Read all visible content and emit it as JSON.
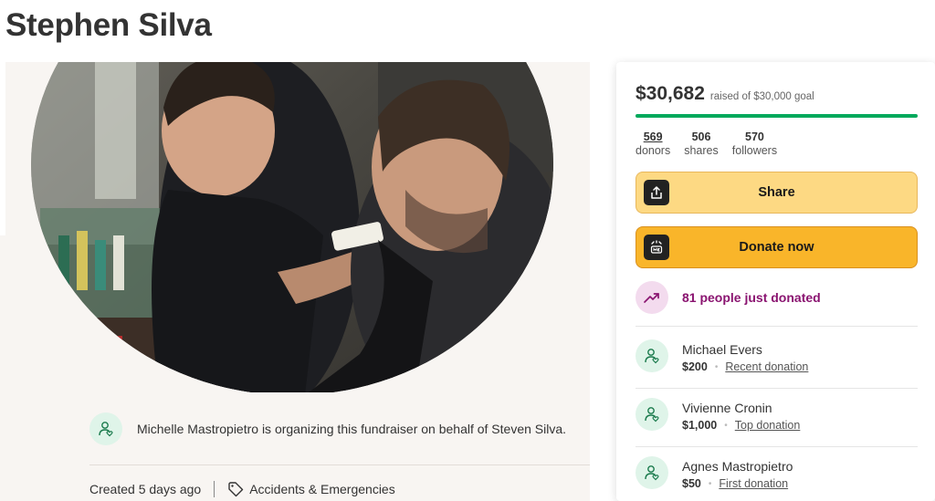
{
  "page": {
    "title": "Stephen Silva"
  },
  "organizer": {
    "text": "Michelle Mastropietro is organizing this fundraiser on behalf of Steven Silva."
  },
  "meta": {
    "created": "Created 5 days ago",
    "category": "Accidents & Emergencies"
  },
  "summary": {
    "raised": "$30,682",
    "goal_text": "raised of $30,000 goal",
    "progress_fraction": 1.0,
    "stats": [
      {
        "num": "569",
        "label": "donors"
      },
      {
        "num": "506",
        "label": "shares"
      },
      {
        "num": "570",
        "label": "followers"
      }
    ],
    "share_label": "Share",
    "donate_label": "Donate now",
    "trend_text": "81 people just donated"
  },
  "donations": [
    {
      "name": "Michael Evers",
      "amount": "$200",
      "kind": "Recent donation"
    },
    {
      "name": "Vivienne Cronin",
      "amount": "$1,000",
      "kind": "Top donation"
    },
    {
      "name": "Agnes Mastropietro",
      "amount": "$50",
      "kind": "First donation"
    }
  ],
  "colors": {
    "accent_green": "#02a95c",
    "share_button": "#fdd983",
    "donate_button": "#f9b52a",
    "trend_text": "#8a1470",
    "avatar_bg": "#dff4e9"
  }
}
